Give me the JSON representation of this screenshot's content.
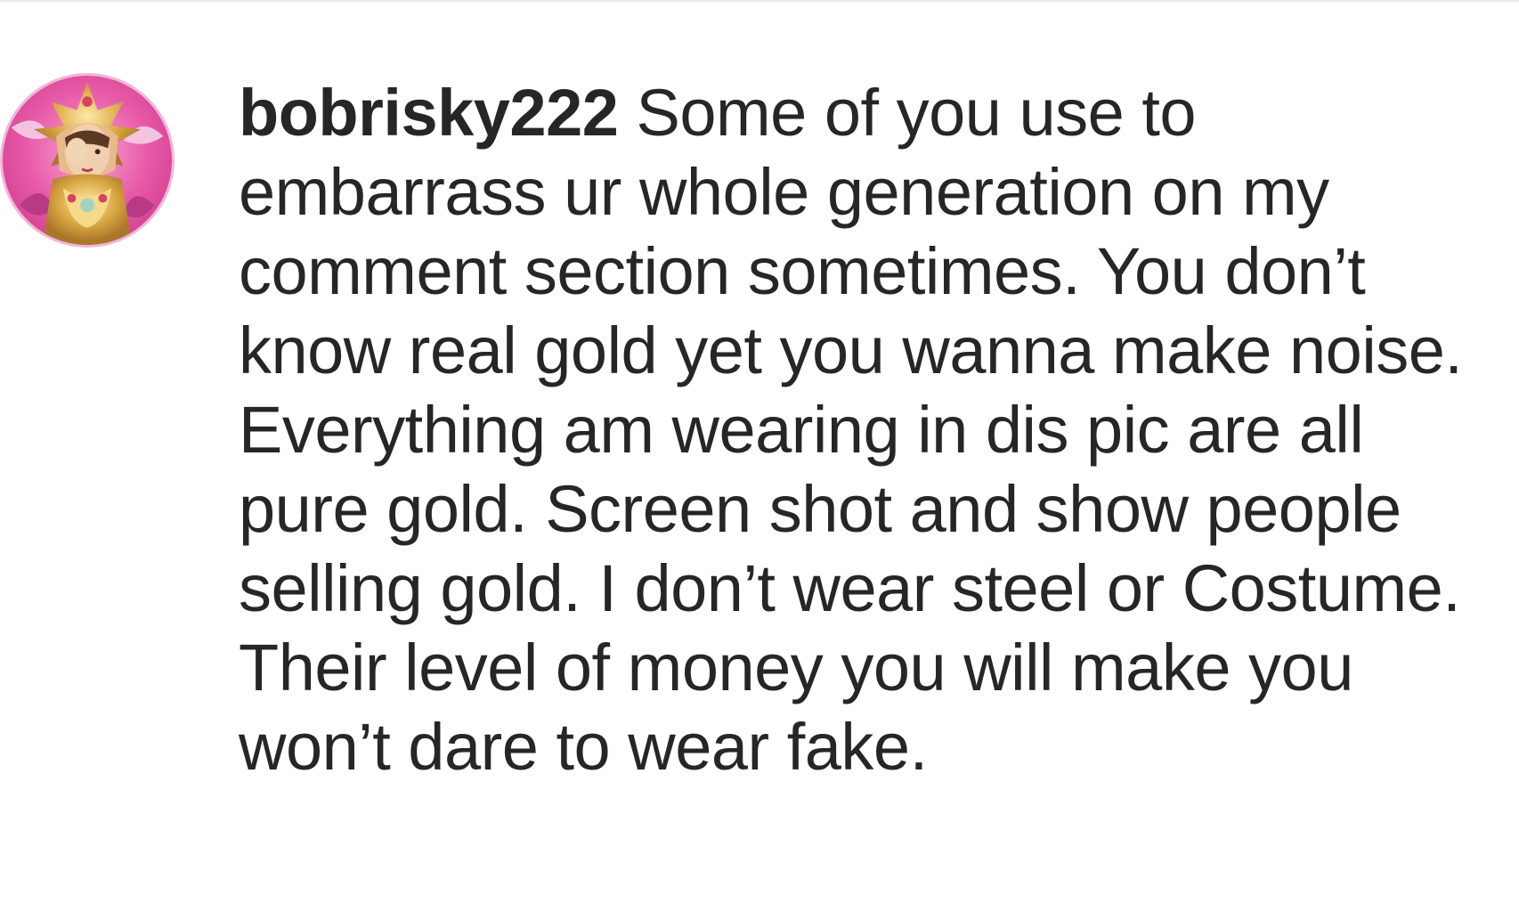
{
  "comment": {
    "username": "bobrisky222",
    "text": "Some of you use to embarrass ur whole generation on my comment section sometimes. You don’t know real gold yet you wanna make noise. Everything am wearing in dis pic are all pure gold. Screen shot and show people selling gold. I don’t wear steel or Costume. Their level of money you will make you won’t dare to wear fake.",
    "avatar_icon": "profile-photo-avatar"
  },
  "colors": {
    "text": "#262626",
    "background": "#ffffff",
    "avatar_bg": "#e85aa8"
  }
}
